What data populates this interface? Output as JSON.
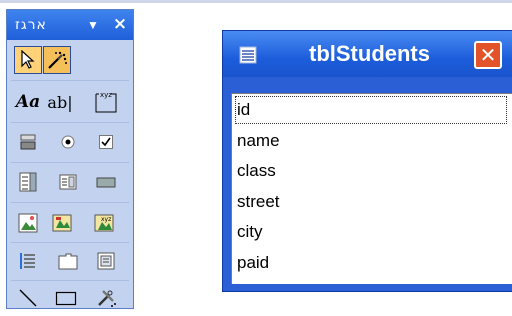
{
  "toolbox": {
    "title": "ארגז",
    "dropdown_glyph": "▼",
    "close_glyph": "×",
    "tools": [
      [
        "select-objects-icon",
        "control-wizards-icon"
      ],
      [
        "label-icon",
        "textbox-icon",
        "option-group-icon"
      ],
      [
        "toggle-button-icon",
        "option-button-icon",
        "checkbox-icon"
      ],
      [
        "combo-box-icon",
        "list-box-icon",
        "command-button-icon"
      ],
      [
        "image-icon",
        "unbound-object-frame-icon",
        "bound-object-frame-icon"
      ],
      [
        "page-break-icon",
        "tab-control-icon",
        "subform-icon"
      ],
      [
        "line-icon",
        "rectangle-icon",
        "more-controls-icon"
      ]
    ],
    "label_text": "Aa",
    "textbox_text": "ab|",
    "option_group_text": "xyz"
  },
  "table_window": {
    "title": "tblStudents",
    "close_glyph": "✕",
    "fields": [
      "id",
      "name",
      "class",
      "street",
      "city",
      "paid"
    ]
  }
}
